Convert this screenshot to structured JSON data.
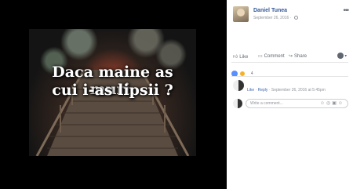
{
  "photo": {
    "caption_line1": "Daca maine as muri,",
    "caption_line2": "cui i-as lipsii ?"
  },
  "post": {
    "author": "Daniel Tunea",
    "date": "September 26, 2016 ·",
    "more": "•••"
  },
  "actions": {
    "like": "Like",
    "comment": "Comment",
    "share": "Share"
  },
  "reactions": {
    "count": "4"
  },
  "comment": {
    "like": "Like",
    "reply": "Reply",
    "separator": " · ",
    "timestamp": "September 26, 2016 at 5:45pm"
  },
  "composer": {
    "placeholder": "Write a comment...",
    "icons": "☺◎▣☺"
  },
  "colors": {
    "link": "#365899",
    "meta": "#90949c",
    "action": "#606770"
  },
  "icons": [
    "globe-icon",
    "more-icon",
    "like-icon",
    "comment-icon",
    "share-icon",
    "reaction-selector-icon",
    "like-reaction-icon",
    "wow-reaction-icon",
    "emoji-icon",
    "camera-icon",
    "gif-icon",
    "sticker-icon"
  ]
}
